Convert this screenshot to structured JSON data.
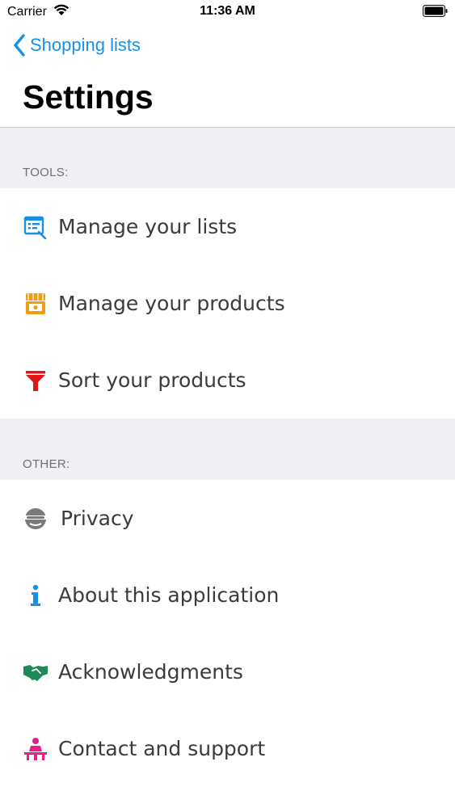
{
  "status_bar": {
    "carrier": "Carrier",
    "time": "11:36 AM"
  },
  "nav": {
    "back_label": "Shopping lists",
    "title": "Settings"
  },
  "sections": [
    {
      "header": "TOOLS:",
      "items": [
        {
          "label": "Manage your lists",
          "icon": "list-edit-icon",
          "color": "#1a8fe8"
        },
        {
          "label": "Manage your products",
          "icon": "shop-icon",
          "color": "#f39c12"
        },
        {
          "label": "Sort your products",
          "icon": "funnel-icon",
          "color": "#e0161b"
        }
      ]
    },
    {
      "header": "OTHER:",
      "items": [
        {
          "label": "Privacy",
          "icon": "privacy-spy-icon",
          "color": "#7a7a7a"
        },
        {
          "label": "About this application",
          "icon": "info-icon",
          "color": "#1a8fe8"
        },
        {
          "label": "Acknowledgments",
          "icon": "handshake-icon",
          "color": "#1e8a5a"
        },
        {
          "label": "Contact and support",
          "icon": "support-person-icon",
          "color": "#e91e8c"
        }
      ]
    }
  ],
  "colors": {
    "accent": "#1a8fe8",
    "section_background": "#efeff4",
    "section_header_text": "#6d6d72"
  }
}
